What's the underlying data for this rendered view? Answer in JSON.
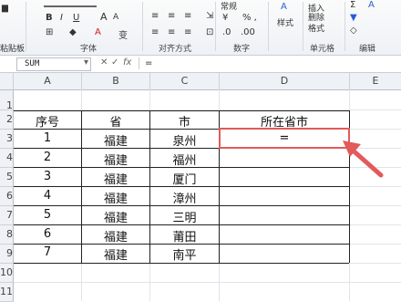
{
  "ribbon": {
    "left_label": "粘贴板",
    "font_group": "字体",
    "align_group": "对齐方式",
    "number_group": "数字",
    "number_format": "常规",
    "percent": "% ,",
    "style_btn": "样式",
    "insert_btn": "插入",
    "delete_btn": "删除",
    "format_btn": "格式",
    "cells_group": "单元格",
    "edit_group": "编辑",
    "bold": "B",
    "italic": "I",
    "underline": "U",
    "font_grow": "A",
    "font_shrink": "A",
    "wen": "变",
    "sigma": "Σ",
    "sort": "A"
  },
  "formula_bar": {
    "name_box": "SUM",
    "cancel": "✕",
    "enter": "✓",
    "fx": "fx",
    "content": "="
  },
  "columns": [
    "A",
    "B",
    "C",
    "D",
    "E"
  ],
  "rows": [
    "1",
    "2",
    "3",
    "4",
    "5",
    "6",
    "7",
    "8",
    "9",
    "10",
    "11"
  ],
  "table": {
    "headers": [
      "序号",
      "省",
      "市",
      "所在省市"
    ],
    "rows": [
      [
        "1",
        "福建",
        "泉州",
        "="
      ],
      [
        "2",
        "福建",
        "福州",
        ""
      ],
      [
        "3",
        "福建",
        "厦门",
        ""
      ],
      [
        "4",
        "福建",
        "漳州",
        ""
      ],
      [
        "5",
        "福建",
        "三明",
        ""
      ],
      [
        "6",
        "福建",
        "莆田",
        ""
      ],
      [
        "7",
        "福建",
        "南平",
        ""
      ]
    ]
  },
  "colors": {
    "selection": "#e25a5a",
    "arrow": "#e25a5a"
  }
}
